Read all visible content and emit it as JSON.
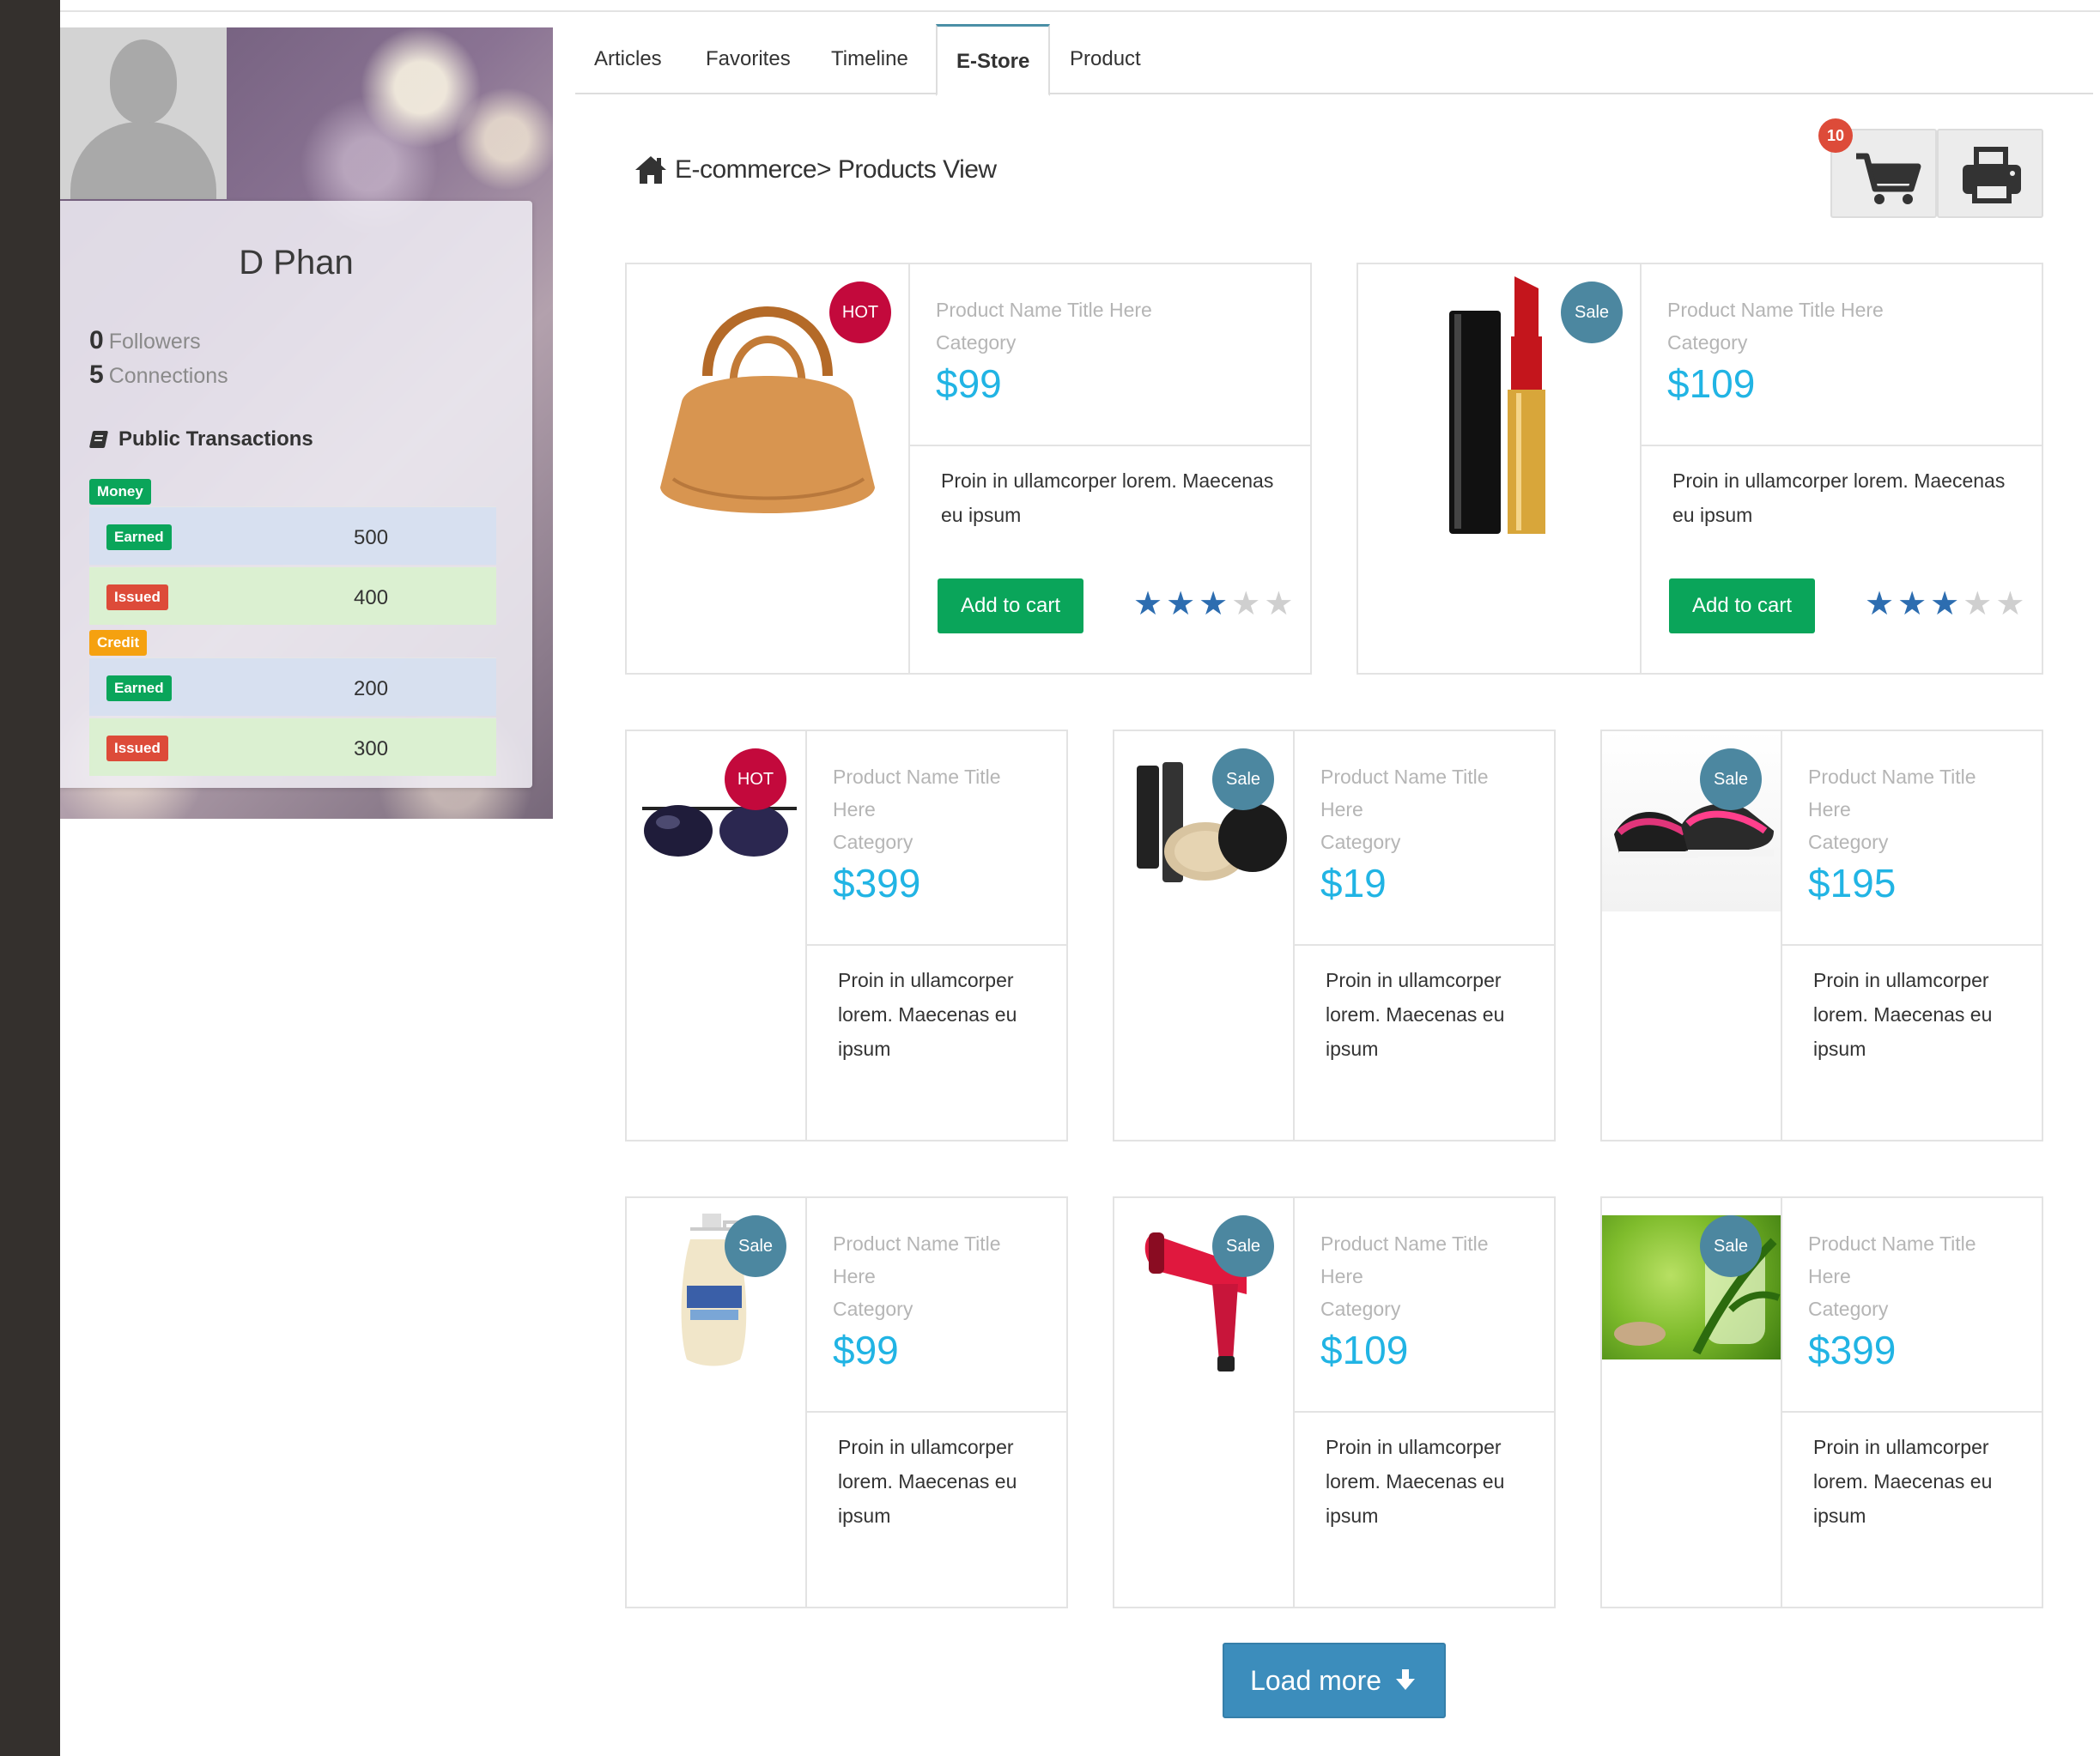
{
  "profile": {
    "name": "D Phan",
    "followers_count": "0",
    "followers_label": "Followers",
    "connections_count": "5",
    "connections_label": "Connections",
    "transactions_title": "Public Transactions",
    "groups": [
      {
        "label": "Money",
        "color": "#0aa55a",
        "rows": [
          {
            "type": "Earned",
            "value": "500"
          },
          {
            "type": "Issued",
            "value": "400"
          }
        ]
      },
      {
        "label": "Credit",
        "color": "#f5a110",
        "rows": [
          {
            "type": "Earned",
            "value": "200"
          },
          {
            "type": "Issued",
            "value": "300"
          }
        ]
      }
    ]
  },
  "tabs": [
    {
      "label": "Articles"
    },
    {
      "label": "Favorites"
    },
    {
      "label": "Timeline"
    },
    {
      "label": "E-Store",
      "active": true
    },
    {
      "label": "Product"
    }
  ],
  "breadcrumb": "E-commerce> Products View",
  "cart_count": "10",
  "products": [
    {
      "image": "handbag",
      "badge": "HOT",
      "name": "Product Name Title Here",
      "category": "Category",
      "price": "$99",
      "description": "Proin in ullamcorper lorem. Maecenas eu ipsum",
      "add_label": "Add to cart",
      "rating": 3
    },
    {
      "image": "lipstick",
      "badge": "Sale",
      "name": "Product Name Title Here",
      "category": "Category",
      "price": "$109",
      "description": "Proin in ullamcorper lorem. Maecenas eu ipsum",
      "add_label": "Add to cart",
      "rating": 3
    },
    {
      "image": "sunglasses",
      "badge": "HOT",
      "name": "Product Name Title Here",
      "category": "Category",
      "price": "$399",
      "description": "Proin in ullamcorper lorem. Maecenas eu ipsum"
    },
    {
      "image": "makeup-kit",
      "badge": "Sale",
      "name": "Product Name Title Here",
      "category": "Category",
      "price": "$19",
      "description": "Proin in ullamcorper lorem. Maecenas eu ipsum"
    },
    {
      "image": "sneakers",
      "badge": "Sale",
      "name": "Product Name Title Here",
      "category": "Category",
      "price": "$195",
      "description": "Proin in ullamcorper lorem. Maecenas eu ipsum"
    },
    {
      "image": "lotion-bottle",
      "badge": "Sale",
      "name": "Product Name Title Here",
      "category": "Category",
      "price": "$99",
      "description": "Proin in ullamcorper lorem. Maecenas eu ipsum"
    },
    {
      "image": "hair-dryer",
      "badge": "Sale",
      "name": "Product Name Title Here",
      "category": "Category",
      "price": "$109",
      "description": "Proin in ullamcorper lorem. Maecenas eu ipsum"
    },
    {
      "image": "spa-stones",
      "badge": "Sale",
      "name": "Product Name Title Here",
      "category": "Category",
      "price": "$399",
      "description": "Proin in ullamcorper lorem. Maecenas eu ipsum"
    }
  ],
  "load_more_label": "Load more",
  "colors": {
    "price": "#21b4e4",
    "add_to_cart": "#0aa55a",
    "hot_badge": "#c3093c",
    "sale_badge": "#4c87a0",
    "star_on": "#2d6db0",
    "load_more": "#3c8dbc",
    "cart_badge": "#dd4b39"
  },
  "icons": {
    "home": "home-icon",
    "cart": "shopping-cart-icon",
    "print": "printer-icon",
    "load_more": "arrow-down-icon",
    "transactions": "book-icon"
  }
}
